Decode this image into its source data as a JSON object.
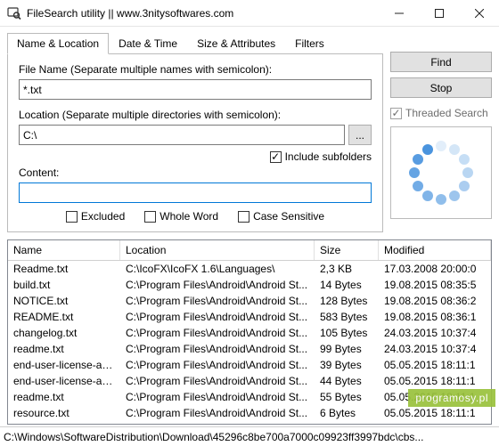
{
  "window": {
    "title": "FileSearch utility || www.3nitysoftwares.com"
  },
  "tabs": {
    "items": [
      {
        "label": "Name & Location"
      },
      {
        "label": "Date & Time"
      },
      {
        "label": "Size & Attributes"
      },
      {
        "label": "Filters"
      }
    ]
  },
  "form": {
    "filename_label": "File Name (Separate multiple names with semicolon):",
    "filename_value": "*.txt",
    "location_label": "Location (Separate multiple directories with semicolon):",
    "location_value": "C:\\",
    "browse_ellipsis": "...",
    "include_subfolders_label": "Include subfolders",
    "include_subfolders_checked": "✓",
    "content_label": "Content:",
    "content_value": "",
    "excluded_label": "Excluded",
    "wholeword_label": "Whole Word",
    "casesensitive_label": "Case Sensitive"
  },
  "side": {
    "find_label": "Find",
    "stop_label": "Stop",
    "threaded_label": "Threaded Search",
    "threaded_checked": "✓"
  },
  "columns": {
    "name": "Name",
    "location": "Location",
    "size": "Size",
    "modified": "Modified"
  },
  "rows": [
    {
      "name": "Readme.txt",
      "location": "C:\\IcoFX\\IcoFX 1.6\\Languages\\",
      "size": "2,3 KB",
      "modified": "17.03.2008 20:00:0"
    },
    {
      "name": "build.txt",
      "location": "C:\\Program Files\\Android\\Android St...",
      "size": "14 Bytes",
      "modified": "19.08.2015 08:35:5"
    },
    {
      "name": "NOTICE.txt",
      "location": "C:\\Program Files\\Android\\Android St...",
      "size": "128 Bytes",
      "modified": "19.08.2015 08:36:2"
    },
    {
      "name": "README.txt",
      "location": "C:\\Program Files\\Android\\Android St...",
      "size": "583 Bytes",
      "modified": "19.08.2015 08:36:1"
    },
    {
      "name": "changelog.txt",
      "location": "C:\\Program Files\\Android\\Android St...",
      "size": "105 Bytes",
      "modified": "24.03.2015 10:37:4"
    },
    {
      "name": "readme.txt",
      "location": "C:\\Program Files\\Android\\Android St...",
      "size": "99 Bytes",
      "modified": "24.03.2015 10:37:4"
    },
    {
      "name": "end-user-license-agre...",
      "location": "C:\\Program Files\\Android\\Android St...",
      "size": "39 Bytes",
      "modified": "05.05.2015 18:11:1"
    },
    {
      "name": "end-user-license-agre...",
      "location": "C:\\Program Files\\Android\\Android St...",
      "size": "44 Bytes",
      "modified": "05.05.2015 18:11:1"
    },
    {
      "name": "readme.txt",
      "location": "C:\\Program Files\\Android\\Android St...",
      "size": "55 Bytes",
      "modified": "05.05.2015 18:11:1"
    },
    {
      "name": "resource.txt",
      "location": "C:\\Program Files\\Android\\Android St...",
      "size": "6 Bytes",
      "modified": "05.05.2015 18:11:1"
    }
  ],
  "status": {
    "path": "C:\\Windows\\SoftwareDistribution\\Download\\45296c8be700a7000c09923ff3997bdc\\cbs..."
  },
  "watermark": "programosy.pl"
}
